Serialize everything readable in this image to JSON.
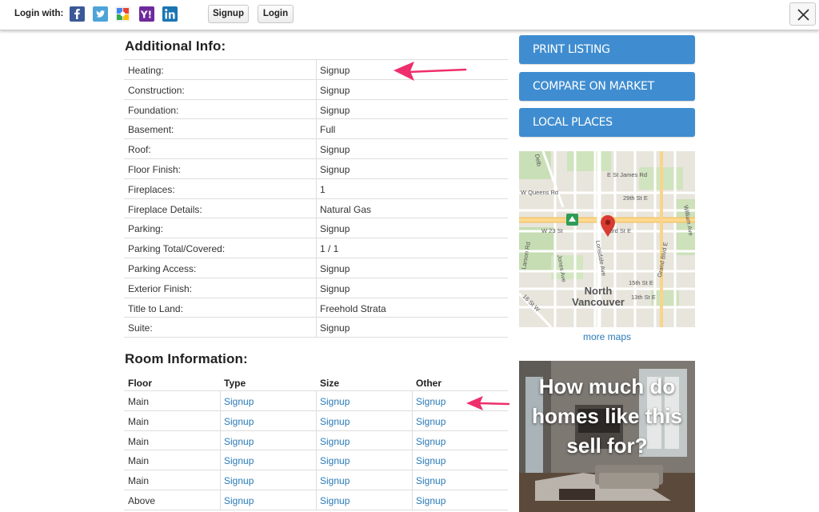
{
  "topbar": {
    "login_with": "Login with:",
    "signup_label": "Signup",
    "login_label": "Login"
  },
  "additional_info": {
    "title": "Additional Info:",
    "rows": [
      {
        "label": "Heating:",
        "value": "Signup",
        "link": true
      },
      {
        "label": "Construction:",
        "value": "Signup",
        "link": true
      },
      {
        "label": "Foundation:",
        "value": "Signup",
        "link": true
      },
      {
        "label": "Basement:",
        "value": "Full",
        "link": false
      },
      {
        "label": "Roof:",
        "value": "Signup",
        "link": true
      },
      {
        "label": "Floor Finish:",
        "value": "Signup",
        "link": true
      },
      {
        "label": "Fireplaces:",
        "value": "1",
        "link": false
      },
      {
        "label": "Fireplace Details:",
        "value": "Natural Gas",
        "link": false
      },
      {
        "label": "Parking:",
        "value": "Signup",
        "link": true
      },
      {
        "label": "Parking Total/Covered:",
        "value": "1 / 1",
        "link": false
      },
      {
        "label": "Parking Access:",
        "value": "Signup",
        "link": true
      },
      {
        "label": "Exterior Finish:",
        "value": "Signup",
        "link": true
      },
      {
        "label": "Title to Land:",
        "value": "Freehold Strata",
        "link": false
      },
      {
        "label": "Suite:",
        "value": "Signup",
        "link": true
      }
    ]
  },
  "room_info": {
    "title": "Room Information:",
    "headers": [
      "Floor",
      "Type",
      "Size",
      "Other"
    ],
    "rows": [
      {
        "floor": "Main",
        "type": "Signup",
        "size": "Signup",
        "other": "Signup"
      },
      {
        "floor": "Main",
        "type": "Signup",
        "size": "Signup",
        "other": "Signup"
      },
      {
        "floor": "Main",
        "type": "Signup",
        "size": "Signup",
        "other": "Signup"
      },
      {
        "floor": "Main",
        "type": "Signup",
        "size": "Signup",
        "other": "Signup"
      },
      {
        "floor": "Main",
        "type": "Signup",
        "size": "Signup",
        "other": "Signup"
      },
      {
        "floor": "Above",
        "type": "Signup",
        "size": "Signup",
        "other": "Signup"
      }
    ]
  },
  "sidebar": {
    "buttons": [
      "PRINT LISTING",
      "COMPARE ON MARKET",
      "LOCAL PLACES"
    ],
    "map": {
      "labels": {
        "e_st_james": "E St James Rd",
        "w_queens": "W Queens Rd",
        "e_29th": "29th St E",
        "w_23": "W 23 St",
        "e_23": "3rd St E",
        "william": "William Ave",
        "larson": "Larson Rd",
        "jones": "Jones Ave",
        "lonsdale": "Lonsdale Ave",
        "st_15": "15th St E",
        "st_13": "13th St E",
        "grand": "Grand Blvd E",
        "city_line1": "North",
        "city_line2": "Vancouver",
        "delbrook": "Delb",
        "w16": "16 St W"
      }
    },
    "more_maps": "more maps",
    "promo_text": "How much do homes like this sell for?"
  },
  "colors": {
    "link": "#2a7ab8",
    "button": "#3f8dd0",
    "arrow": "#ee2f6c"
  }
}
